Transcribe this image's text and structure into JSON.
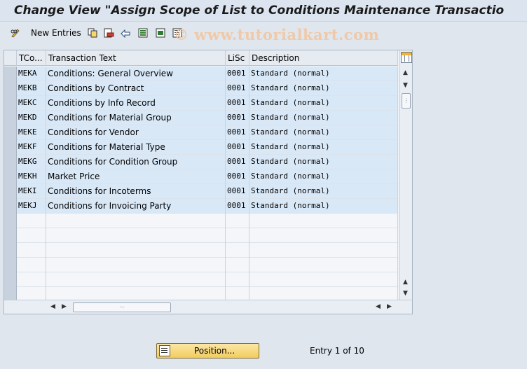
{
  "title": "Change View \"Assign Scope of List to Conditions Maintenance Transactio",
  "toolbar": {
    "new_entries_label": "New Entries",
    "watermark": "© www.tutorialkart.com"
  },
  "table": {
    "columns": [
      "TCo...",
      "Transaction Text",
      "LiSc",
      "Description"
    ],
    "rows": [
      {
        "tcode": "MEKA",
        "text": "Conditions: General Overview",
        "lisc": "0001",
        "desc": "Standard (normal)"
      },
      {
        "tcode": "MEKB",
        "text": "Conditions by Contract",
        "lisc": "0001",
        "desc": "Standard (normal)"
      },
      {
        "tcode": "MEKC",
        "text": "Conditions by Info Record",
        "lisc": "0001",
        "desc": "Standard (normal)"
      },
      {
        "tcode": "MEKD",
        "text": "Conditions for Material Group",
        "lisc": "0001",
        "desc": "Standard (normal)"
      },
      {
        "tcode": "MEKE",
        "text": "Conditions for Vendor",
        "lisc": "0001",
        "desc": "Standard (normal)"
      },
      {
        "tcode": "MEKF",
        "text": "Conditions for Material Type",
        "lisc": "0001",
        "desc": "Standard (normal)"
      },
      {
        "tcode": "MEKG",
        "text": "Conditions for Condition Group",
        "lisc": "0001",
        "desc": "Standard (normal)"
      },
      {
        "tcode": "MEKH",
        "text": "Market Price",
        "lisc": "0001",
        "desc": "Standard (normal)"
      },
      {
        "tcode": "MEKI",
        "text": "Conditions for Incoterms",
        "lisc": "0001",
        "desc": "Standard (normal)"
      },
      {
        "tcode": "MEKJ",
        "text": "Conditions for Invoicing Party",
        "lisc": "0001",
        "desc": "Standard (normal)"
      }
    ],
    "empty_rows": 6
  },
  "footer": {
    "position_label": "Position...",
    "entry_info": "Entry 1 of 10"
  },
  "icons": [
    "pencil-glasses-icon",
    "copy-icon",
    "delete-icon",
    "undo-icon",
    "select-all-icon",
    "select-block-icon",
    "deselect-all-icon",
    "column-config-icon",
    "position-icon"
  ]
}
